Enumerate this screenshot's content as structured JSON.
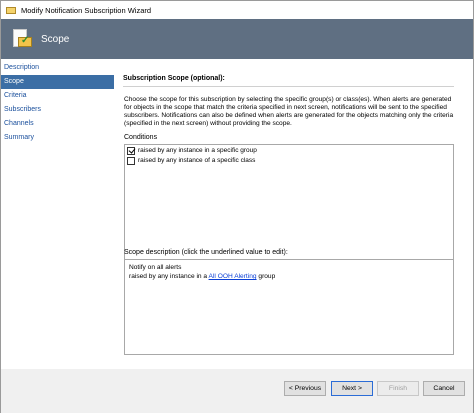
{
  "window": {
    "title": "Modify Notification Subscription Wizard"
  },
  "banner": {
    "heading": "Scope"
  },
  "nav": {
    "items": [
      {
        "label": "Description",
        "selected": false
      },
      {
        "label": "Scope",
        "selected": true
      },
      {
        "label": "Criteria",
        "selected": false
      },
      {
        "label": "Subscribers",
        "selected": false
      },
      {
        "label": "Channels",
        "selected": false
      },
      {
        "label": "Summary",
        "selected": false
      }
    ]
  },
  "main": {
    "section_title": "Subscription Scope (optional):",
    "description": "Choose the scope for this subscription by selecting the specific group(s) or class(es). When alerts are generated for objects in the scope that match the criteria specified in next screen, notifications will be sent to the specified subscribers. Notifications can also be defined when alerts are generated for the objects matching only the criteria (specified in the next screen) without providing the scope.",
    "conditions_label": "Conditions",
    "conditions": [
      {
        "label": "raised by any instance in a specific group",
        "checked": true
      },
      {
        "label": "raised by any instance of a specific class",
        "checked": false
      }
    ],
    "scope_desc_label": "Scope description (click the underlined value to edit):",
    "scope_desc": {
      "line1": "Notify on all alerts",
      "line2_prefix": "raised by any instance in a",
      "link": "All OOH Alerting",
      "line2_suffix": "group"
    }
  },
  "footer": {
    "prev_label": "< Previous",
    "next_label": "Next >",
    "finish_label": "Finish",
    "cancel_label": "Cancel"
  }
}
